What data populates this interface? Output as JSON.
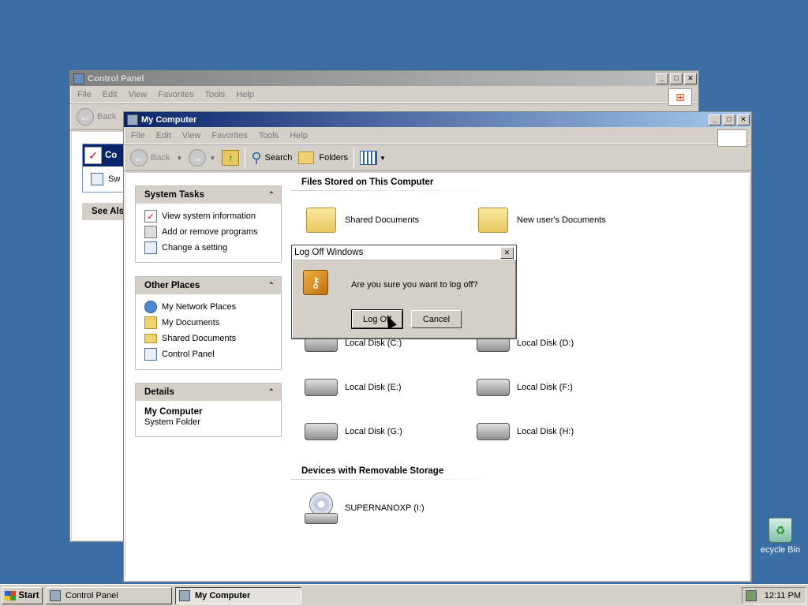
{
  "control_panel_window": {
    "title": "Control Panel",
    "menu": [
      "File",
      "Edit",
      "View",
      "Favorites",
      "Tools",
      "Help"
    ],
    "back_label": "Back",
    "panel_title": "Co",
    "panel_item": "Sw",
    "see_also": "See Als"
  },
  "my_computer_window": {
    "title": "My Computer",
    "menu": [
      "File",
      "Edit",
      "View",
      "Favorites",
      "Tools",
      "Help"
    ],
    "toolbar": {
      "back": "Back",
      "search": "Search",
      "folders": "Folders"
    },
    "system_tasks": {
      "title": "System Tasks",
      "items": [
        {
          "label": "View system information",
          "icon": "system-info-icon"
        },
        {
          "label": "Add or remove programs",
          "icon": "add-remove-icon"
        },
        {
          "label": "Change a setting",
          "icon": "control-panel-icon"
        }
      ]
    },
    "other_places": {
      "title": "Other Places",
      "items": [
        {
          "label": "My Network Places",
          "icon": "network-icon"
        },
        {
          "label": "My Documents",
          "icon": "documents-icon"
        },
        {
          "label": "Shared Documents",
          "icon": "folder-icon"
        },
        {
          "label": "Control Panel",
          "icon": "control-panel-icon"
        }
      ]
    },
    "details": {
      "title": "Details",
      "name": "My Computer",
      "type": "System Folder"
    },
    "sections": {
      "files": {
        "title": "Files Stored on This Computer",
        "items": [
          "Shared Documents",
          "New user's Documents"
        ]
      },
      "drives": {
        "items": [
          "Local Disk (C:)",
          "Local Disk (D:)",
          "Local Disk (E:)",
          "Local Disk (F:)",
          "Local Disk (G:)",
          "Local Disk (H:)"
        ]
      },
      "removable": {
        "title": "Devices with Removable Storage",
        "items": [
          "SUPERNANOXP (I:)"
        ]
      }
    }
  },
  "dialog": {
    "title": "Log Off Windows",
    "message": "Are you sure you want to log off?",
    "ok_label": "Log Off",
    "cancel_label": "Cancel"
  },
  "desktop": {
    "recycle_bin": "ecycle Bin"
  },
  "taskbar": {
    "start_label": "Start",
    "tasks": [
      "Control Panel",
      "My Computer"
    ],
    "clock": "12:11 PM"
  },
  "colors": {
    "desktop": "#3a6ea5",
    "active_title": "#0a246a",
    "inactive_title": "#808080"
  }
}
